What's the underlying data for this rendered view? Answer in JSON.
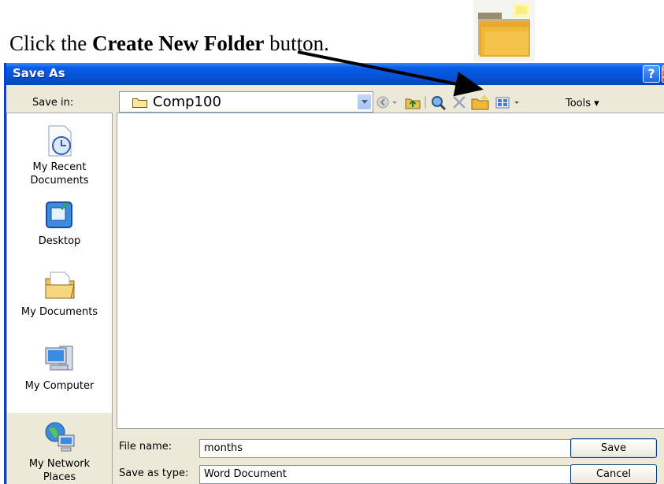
{
  "instruction": {
    "prefix": "Click the ",
    "bold": "Create New Folder",
    "suffix": " button."
  },
  "window": {
    "title": "Save As",
    "help_glyph": "?",
    "close_glyph": "X"
  },
  "save_in": {
    "label": "Save in:",
    "value": "Comp100"
  },
  "toolbar": {
    "icons": [
      "back-icon",
      "up-folder-icon",
      "search-web-icon",
      "delete-icon",
      "create-new-folder-icon",
      "views-icon"
    ],
    "tools_label": "Tools"
  },
  "places": [
    {
      "label": "My Recent\nDocuments",
      "icon": "recent-documents-icon"
    },
    {
      "label": "Desktop",
      "icon": "desktop-icon"
    },
    {
      "label": "My Documents",
      "icon": "my-documents-icon"
    },
    {
      "label": "My Computer",
      "icon": "my-computer-icon"
    },
    {
      "label": "My Network\nPlaces",
      "icon": "network-places-icon"
    }
  ],
  "file_name": {
    "label": "File name:",
    "value": "months"
  },
  "save_as_type": {
    "label": "Save as type:",
    "value": "Word Document"
  },
  "buttons": {
    "save": "Save",
    "cancel": "Cancel"
  },
  "colors": {
    "titlebar": "#0553d8",
    "dialog_bg": "#ece9d8"
  }
}
